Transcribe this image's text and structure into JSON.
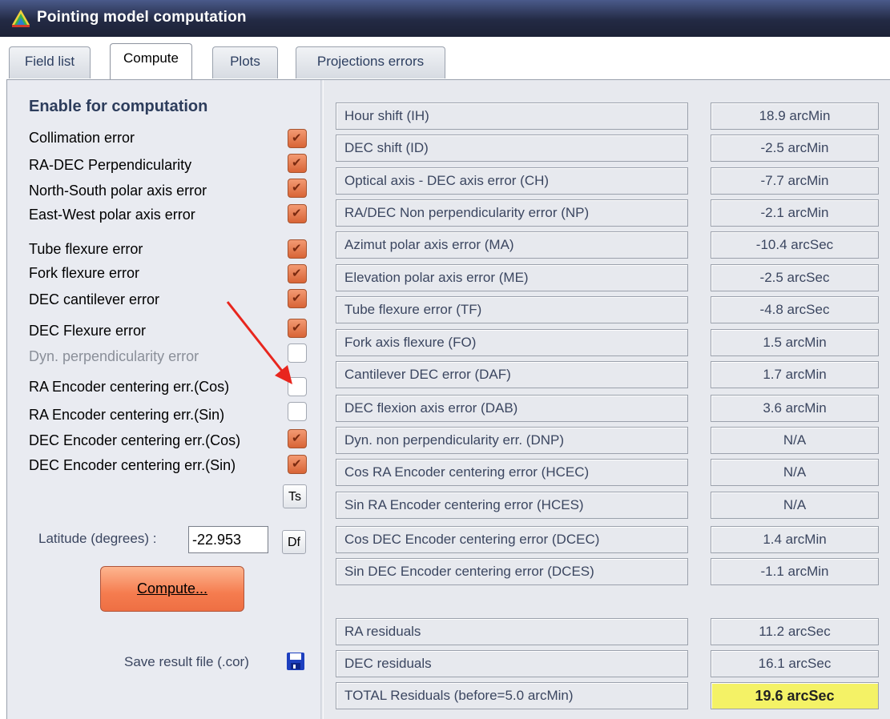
{
  "window": {
    "title": "Pointing model computation"
  },
  "tabs": [
    {
      "label": "Field list",
      "active": false
    },
    {
      "label": "Compute",
      "active": true
    },
    {
      "label": "Plots",
      "active": false
    },
    {
      "label": "Projections errors",
      "active": false
    }
  ],
  "left_panel": {
    "section_title": "Enable for computation",
    "options": [
      {
        "label": "Collimation error",
        "checked": true,
        "enabled": true
      },
      {
        "label": "RA-DEC Perpendicularity",
        "checked": true,
        "enabled": true
      },
      {
        "label": "North-South polar axis error",
        "checked": true,
        "enabled": true
      },
      {
        "label": "East-West polar axis error",
        "checked": true,
        "enabled": true
      },
      {
        "label": "Tube flexure error",
        "checked": true,
        "enabled": true
      },
      {
        "label": "Fork flexure error",
        "checked": true,
        "enabled": true
      },
      {
        "label": "DEC cantilever error",
        "checked": true,
        "enabled": true
      },
      {
        "label": "DEC Flexure error",
        "checked": true,
        "enabled": true
      },
      {
        "label": "Dyn. perpendicularity error",
        "checked": false,
        "enabled": false
      },
      {
        "label": "RA Encoder centering err.(Cos)",
        "checked": false,
        "enabled": true
      },
      {
        "label": "RA Encoder centering err.(Sin)",
        "checked": false,
        "enabled": true
      },
      {
        "label": "DEC Encoder centering err.(Cos)",
        "checked": true,
        "enabled": true
      },
      {
        "label": "DEC Encoder centering err.(Sin)",
        "checked": true,
        "enabled": true
      }
    ],
    "ts_button": "Ts",
    "latitude_label": "Latitude (degrees) :",
    "latitude_value": "-22.953",
    "df_button": "Df",
    "compute_button": "Compute...",
    "save_label": "Save result file (.cor)"
  },
  "results": [
    {
      "label": "Hour shift (IH)",
      "value": "18.9 arcMin"
    },
    {
      "label": "DEC shift (ID)",
      "value": "-2.5 arcMin"
    },
    {
      "label": "Optical axis - DEC axis error (CH)",
      "value": "-7.7 arcMin"
    },
    {
      "label": "RA/DEC Non perpendicularity error (NP)",
      "value": "-2.1 arcMin"
    },
    {
      "label": "Azimut polar axis error (MA)",
      "value": "-10.4 arcSec"
    },
    {
      "label": "Elevation polar axis error (ME)",
      "value": "-2.5 arcSec"
    },
    {
      "label": "Tube flexure error (TF)",
      "value": "-4.8 arcSec"
    },
    {
      "label": "Fork axis flexure (FO)",
      "value": "1.5 arcMin"
    },
    {
      "label": "Cantilever DEC error (DAF)",
      "value": "1.7 arcMin"
    },
    {
      "label": "DEC flexion axis error (DAB)",
      "value": "3.6 arcMin"
    },
    {
      "label": "Dyn. non perpendicularity err. (DNP)",
      "value": "N/A"
    },
    {
      "label": "Cos RA Encoder centering error (HCEC)",
      "value": "N/A"
    },
    {
      "label": "Sin RA Encoder centering error (HCES)",
      "value": "N/A"
    },
    {
      "label": "Cos DEC Encoder centering error (DCEC)",
      "value": "1.4 arcMin"
    },
    {
      "label": "Sin DEC Encoder centering error (DCES)",
      "value": "-1.1 arcMin"
    }
  ],
  "residuals": [
    {
      "label": "RA residuals",
      "value": "11.2 arcSec"
    },
    {
      "label": "DEC residuals",
      "value": "16.1 arcSec"
    },
    {
      "label": "TOTAL Residuals (before=5.0 arcMin)",
      "value": "19.6 arcSec",
      "highlight": true
    }
  ],
  "colors": {
    "accent_checked": "#e8754a",
    "highlight": "#f4f266",
    "annotation_arrow": "#e8261e"
  }
}
